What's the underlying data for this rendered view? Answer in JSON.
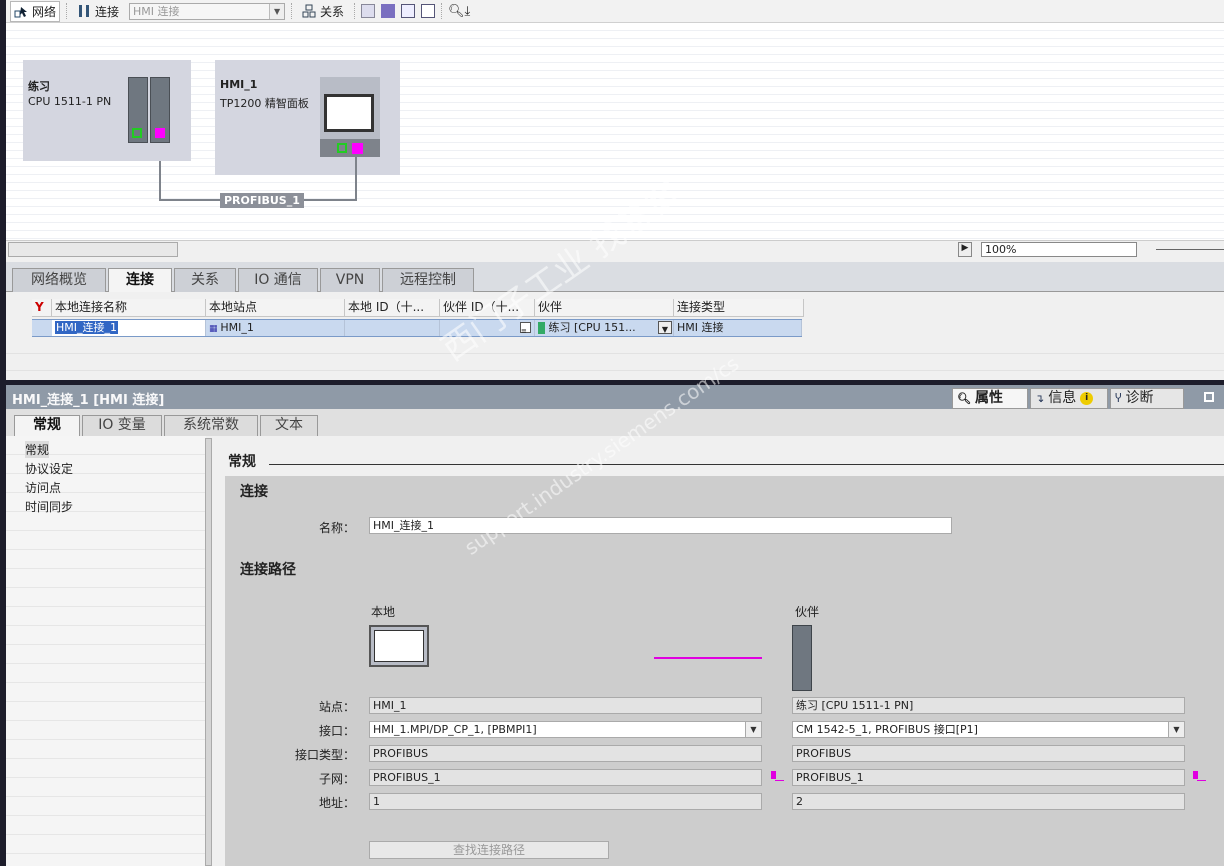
{
  "toolbar": {
    "network": "网络",
    "connections": "连接",
    "connection_type": "HMI 连接",
    "relations": "关系"
  },
  "network": {
    "devices": [
      {
        "name": "练习",
        "model": "CPU 1511-1 PN"
      },
      {
        "name": "HMI_1",
        "model": "TP1200 精智面板"
      }
    ],
    "subnet_label": "PROFIBUS_1",
    "zoom": "100%"
  },
  "overview_tabs": [
    "网络概览",
    "连接",
    "关系",
    "IO 通信",
    "VPN",
    "远程控制"
  ],
  "connections_table": {
    "columns": [
      "本地连接名称",
      "本地站点",
      "本地 ID（十...",
      "伙伴 ID（十...",
      "伙伴",
      "连接类型"
    ],
    "rows": [
      {
        "name": "HMI_连接_1",
        "local_station": "HMI_1",
        "local_id": "",
        "partner_id": "",
        "partner": "练习 [CPU 151...",
        "type": "HMI 连接"
      }
    ]
  },
  "properties": {
    "title": "HMI_连接_1 [HMI 连接]",
    "right_tabs": [
      "属性",
      "信息",
      "诊断"
    ],
    "tabs": [
      "常规",
      "IO 变量",
      "系统常数",
      "文本"
    ],
    "nav": [
      "常规",
      "协议设定",
      "访问点",
      "时间同步"
    ],
    "section": "常规",
    "connection_heading": "连接",
    "name_label": "名称：",
    "name_value": "HMI_连接_1",
    "path_heading": "连接路径",
    "local_heading": "本地",
    "partner_heading": "伙伴",
    "labels": {
      "station": "站点：",
      "interface": "接口：",
      "interface_type": "接口类型：",
      "subnet": "子网：",
      "address": "地址："
    },
    "local": {
      "station": "HMI_1",
      "interface": "HMI_1.MPI/DP_CP_1, [PBMPI1]",
      "interface_type": "PROFIBUS",
      "subnet": "PROFIBUS_1",
      "address": "1"
    },
    "partner": {
      "station": "练习 [CPU 1511-1 PN]",
      "interface": "CM 1542-5_1, PROFIBUS 接口[P1]",
      "interface_type": "PROFIBUS",
      "subnet": "PROFIBUS_1",
      "address": "2"
    },
    "find_path_button": "查找连接路径"
  },
  "watermark": {
    "line1": "西门子工业  找答案",
    "line2": "support.industry.siemens.com/cs"
  },
  "colors": {
    "subnet": "#e000e0",
    "selection": "#c9d9ef",
    "header": "#8f9aa7"
  }
}
